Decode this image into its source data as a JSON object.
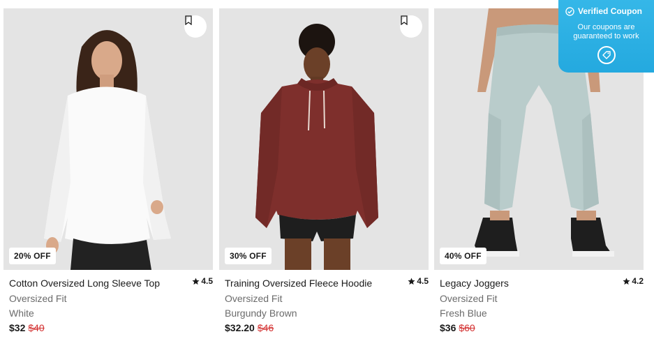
{
  "products": [
    {
      "discount": "20% OFF",
      "name": "Cotton Oversized Long Sleeve Top",
      "rating": "4.5",
      "fit": "Oversized Fit",
      "color": "White",
      "price": "$32",
      "original_price": "$40"
    },
    {
      "discount": "30% OFF",
      "name": "Training Oversized Fleece Hoodie",
      "rating": "4.5",
      "fit": "Oversized Fit",
      "color": "Burgundy Brown",
      "price": "$32.20",
      "original_price": "$46"
    },
    {
      "discount": "40% OFF",
      "name": "Legacy Joggers",
      "rating": "4.2",
      "fit": "Oversized Fit",
      "color": "Fresh Blue",
      "price": "$36",
      "original_price": "$60"
    }
  ],
  "coupon": {
    "title": "Verified Coupon",
    "subtitle_line1": "Our coupons are",
    "subtitle_line2": "guaranteed to work"
  },
  "icons": {
    "wishlist": "bookmark-icon",
    "rating": "star-icon",
    "verified": "check-circle-icon",
    "coupon": "tag-icon"
  },
  "colors": {
    "sale_price": "#d32f2f",
    "coupon_bg": "#2aaee3",
    "image_bg": "#e6e6e6"
  }
}
